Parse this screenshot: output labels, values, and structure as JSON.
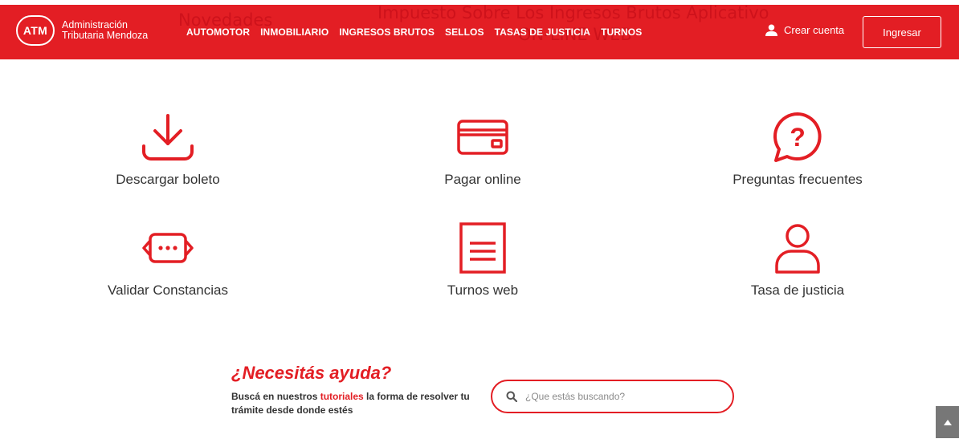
{
  "header": {
    "logo_badge": "ATM",
    "logo_line1": "Administración",
    "logo_line2": "Tributaria Mendoza",
    "nav": [
      "AUTOMOTOR",
      "INMOBILIARIO",
      "INGRESOS BRUTOS",
      "SELLOS",
      "TASAS DE JUSTICIA",
      "TURNOS"
    ],
    "create_account": "Crear cuenta",
    "login": "Ingresar",
    "background_text": [
      "Impuesto Sobre Los Ingresos Brutos Aplicativo",
      "ON-LINE WEB",
      "Novedades"
    ]
  },
  "tiles": [
    {
      "label": "Descargar boleto",
      "icon": "download-icon"
    },
    {
      "label": "Pagar online",
      "icon": "credit-card-icon"
    },
    {
      "label": "Preguntas frecuentes",
      "icon": "question-bubble-icon"
    },
    {
      "label": "Validar Constancias",
      "icon": "chat-dots-icon"
    },
    {
      "label": "Turnos web",
      "icon": "document-icon"
    },
    {
      "label": "Tasa de justicia",
      "icon": "user-icon"
    }
  ],
  "help": {
    "title": "¿Necesitás ayuda?",
    "text_before": "Buscá en nuestros ",
    "text_highlight": "tutoriales",
    "text_after": " la forma de resolver tu trámite desde donde estés",
    "search_placeholder": "¿Que estás buscando?"
  },
  "colors": {
    "brand": "#e31e24",
    "text": "#333333"
  }
}
